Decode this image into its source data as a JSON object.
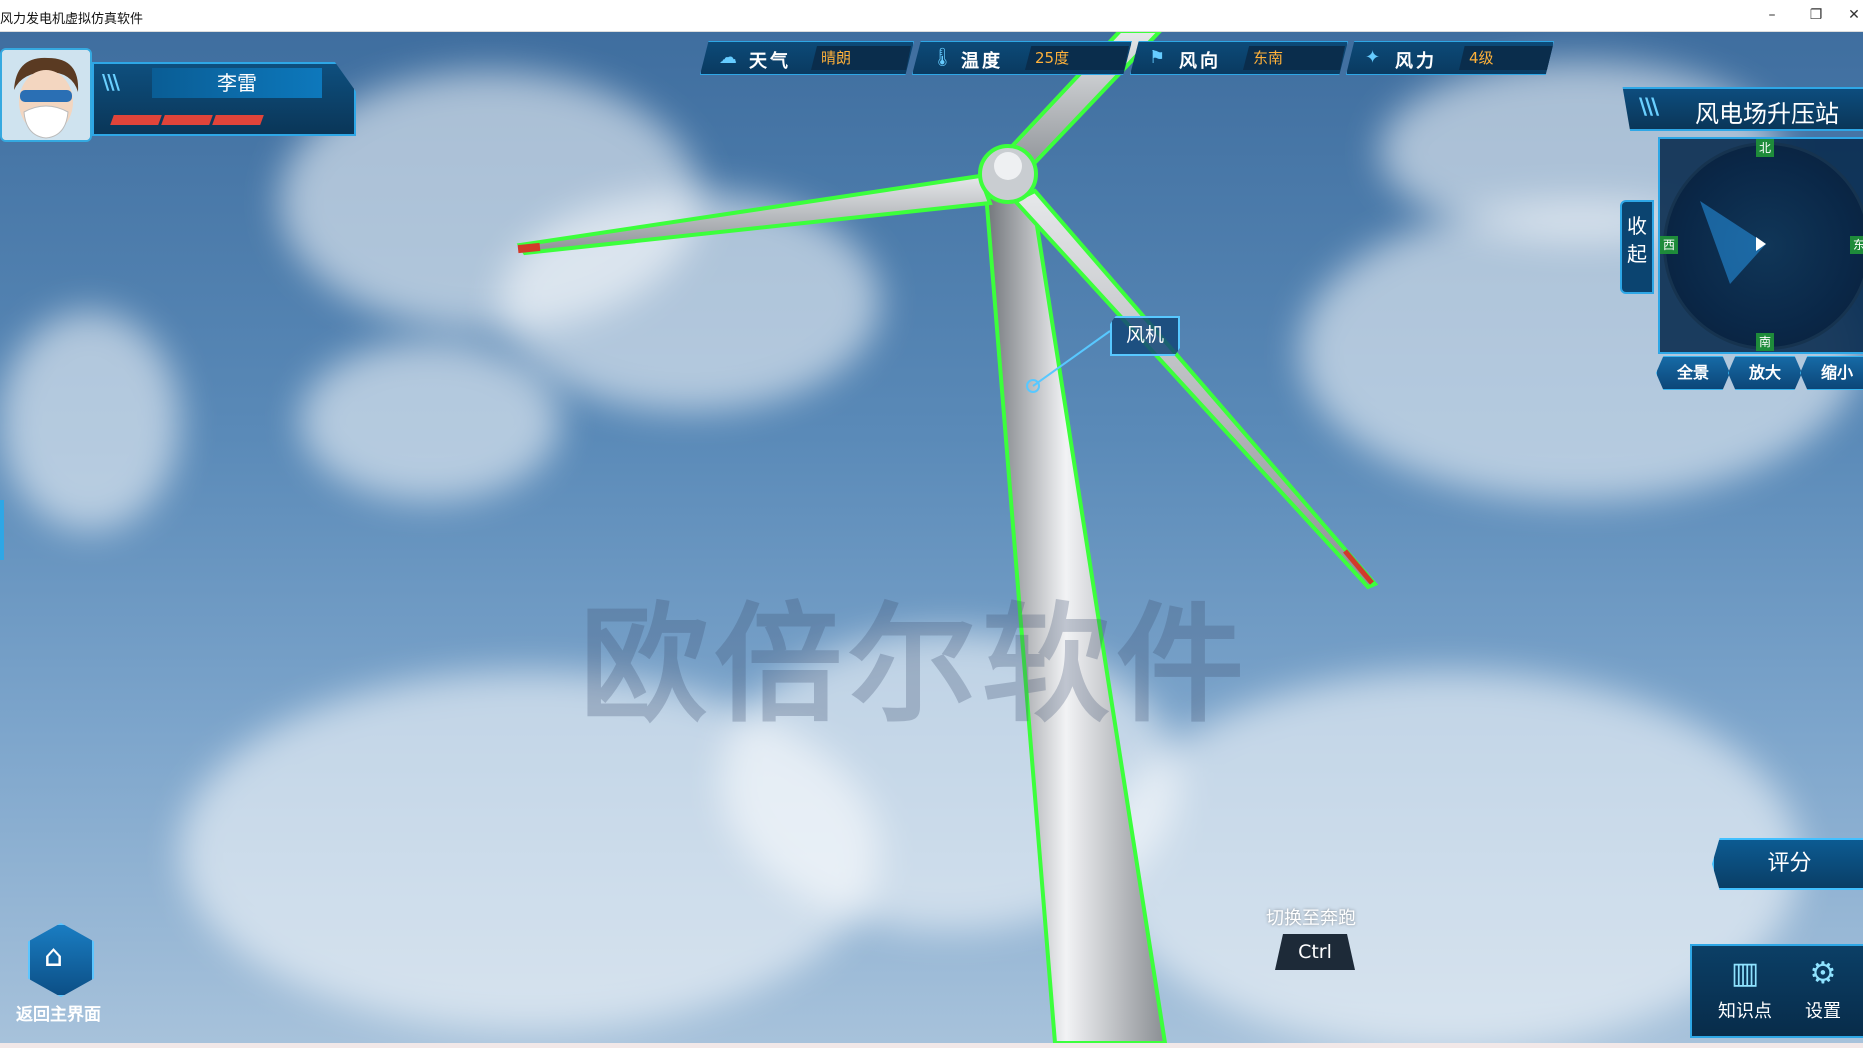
{
  "window": {
    "title": "风力发电机虚拟仿真软件",
    "minimize_glyph": "–",
    "restore_glyph": "❐",
    "close_glyph": "✕"
  },
  "player": {
    "name": "李雷",
    "health_segments": 3
  },
  "weather": [
    {
      "label": "天气",
      "value": "晴朗",
      "icon": "cloud-sun-icon",
      "glyph": "☁"
    },
    {
      "label": "温度",
      "value": "25度",
      "icon": "thermometer-icon",
      "glyph": "🌡"
    },
    {
      "label": "风向",
      "value": "东南",
      "icon": "flag-icon",
      "glyph": "⚑"
    },
    {
      "label": "风力",
      "value": "4级",
      "icon": "wind-icon",
      "glyph": "✦"
    }
  ],
  "minimap": {
    "title": "风电场升压站",
    "collapse_label": "收起",
    "directions": {
      "north": "北",
      "south": "南",
      "west": "西",
      "east": "东"
    },
    "buttons": [
      "全景",
      "放大",
      "缩小"
    ]
  },
  "scene": {
    "callout": "风机",
    "watermark": "欧倍尔软件"
  },
  "home": {
    "label": "返回主界面",
    "icon": "home-icon"
  },
  "hint": {
    "text": "切换至奔跑",
    "key": "Ctrl"
  },
  "score": {
    "label": "评分"
  },
  "tools": [
    {
      "label": "知识点",
      "icon": "book-icon",
      "glyph": "▥"
    },
    {
      "label": "设置",
      "icon": "gear-icon",
      "glyph": "⚙"
    }
  ],
  "colors": {
    "accent": "#2ea7e6",
    "value_text": "#ffb13a",
    "panel": "#0a3658",
    "outline": "#3cff3c",
    "health": "#e0443a"
  }
}
